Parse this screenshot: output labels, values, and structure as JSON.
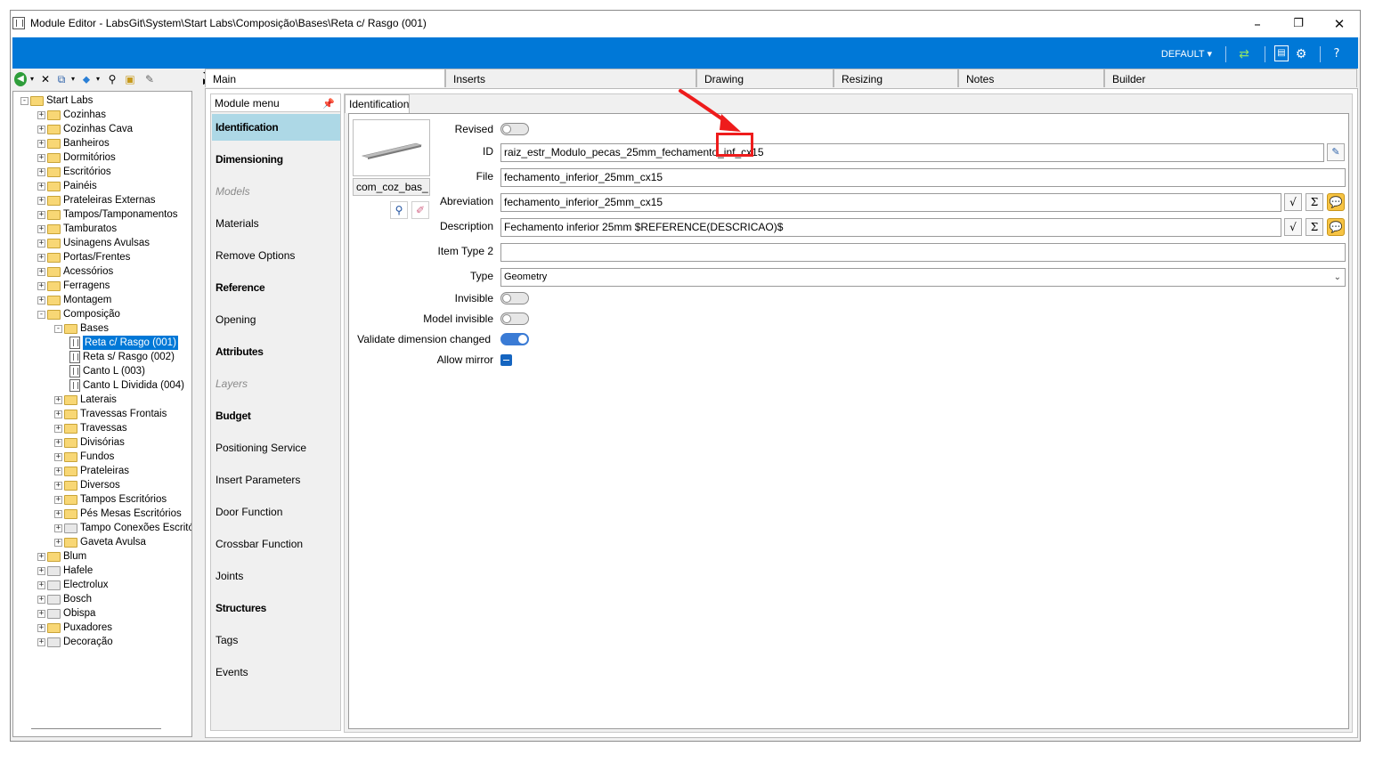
{
  "window": {
    "title": "Module Editor - LabsGit\\System\\Start Labs\\Composição\\Bases\\Reta c/ Rasgo (001)",
    "controls": [
      "–",
      "❐",
      "✕"
    ]
  },
  "bluebar": {
    "profile": "DEFAULT ▾"
  },
  "main_tabs": [
    "Main",
    "Inserts",
    "Drawing",
    "Resizing",
    "Notes",
    "Builder"
  ],
  "tree": {
    "nodes": [
      {
        "label": "Start Labs",
        "level": 0,
        "type": "folder",
        "exp": "−"
      },
      {
        "label": "Cozinhas",
        "level": 1,
        "type": "folder",
        "exp": "+"
      },
      {
        "label": "Cozinhas Cava",
        "level": 1,
        "type": "folder",
        "exp": "+"
      },
      {
        "label": "Banheiros",
        "level": 1,
        "type": "folder",
        "exp": "+"
      },
      {
        "label": "Dormitórios",
        "level": 1,
        "type": "folder",
        "exp": "+"
      },
      {
        "label": "Escritórios",
        "level": 1,
        "type": "folder",
        "exp": "+"
      },
      {
        "label": "Painéis",
        "level": 1,
        "type": "folder",
        "exp": "+"
      },
      {
        "label": "Prateleiras Externas",
        "level": 1,
        "type": "folder",
        "exp": "+"
      },
      {
        "label": "Tampos/Tamponamentos",
        "level": 1,
        "type": "folder",
        "exp": "+"
      },
      {
        "label": "Tamburatos",
        "level": 1,
        "type": "folder",
        "exp": "+"
      },
      {
        "label": "Usinagens Avulsas",
        "level": 1,
        "type": "folder",
        "exp": "+"
      },
      {
        "label": "Portas/Frentes",
        "level": 1,
        "type": "folder",
        "exp": "+"
      },
      {
        "label": "Acessórios",
        "level": 1,
        "type": "folder",
        "exp": "+"
      },
      {
        "label": "Ferragens",
        "level": 1,
        "type": "folder",
        "exp": "+"
      },
      {
        "label": "Montagem",
        "level": 1,
        "type": "folder",
        "exp": "+"
      },
      {
        "label": "Composição",
        "level": 1,
        "type": "folder",
        "exp": "−"
      },
      {
        "label": "Bases",
        "level": 2,
        "type": "folder",
        "exp": "−"
      },
      {
        "label": "Reta c/ Rasgo (001)",
        "level": 3,
        "type": "doc",
        "selected": true
      },
      {
        "label": "Reta s/ Rasgo (002)",
        "level": 3,
        "type": "doc"
      },
      {
        "label": "Canto L (003)",
        "level": 3,
        "type": "doc"
      },
      {
        "label": "Canto L Dividida (004)",
        "level": 3,
        "type": "doc"
      },
      {
        "label": "Laterais",
        "level": 2,
        "type": "folder",
        "exp": "+"
      },
      {
        "label": "Travessas Frontais",
        "level": 2,
        "type": "folder",
        "exp": "+"
      },
      {
        "label": "Travessas",
        "level": 2,
        "type": "folder",
        "exp": "+"
      },
      {
        "label": "Divisórias",
        "level": 2,
        "type": "folder",
        "exp": "+"
      },
      {
        "label": "Fundos",
        "level": 2,
        "type": "folder",
        "exp": "+"
      },
      {
        "label": "Prateleiras",
        "level": 2,
        "type": "folder",
        "exp": "+"
      },
      {
        "label": "Diversos",
        "level": 2,
        "type": "folder",
        "exp": "+"
      },
      {
        "label": "Tampos Escritórios",
        "level": 2,
        "type": "folder",
        "exp": "+"
      },
      {
        "label": "Pés Mesas Escritórios",
        "level": 2,
        "type": "folder",
        "exp": "+"
      },
      {
        "label": "Tampo Conexões Escritórios",
        "level": 2,
        "type": "folder",
        "exp": "+",
        "gray": true
      },
      {
        "label": "Gaveta Avulsa",
        "level": 2,
        "type": "folder",
        "exp": "+"
      },
      {
        "label": "Blum",
        "level": 1,
        "type": "folder",
        "exp": "+"
      },
      {
        "label": "Hafele",
        "level": 1,
        "type": "folder",
        "exp": "+",
        "gray": true
      },
      {
        "label": "Electrolux",
        "level": 1,
        "type": "folder",
        "exp": "+",
        "gray": true
      },
      {
        "label": "Bosch",
        "level": 1,
        "type": "folder",
        "exp": "+",
        "gray": true
      },
      {
        "label": "Obispa",
        "level": 1,
        "type": "folder",
        "exp": "+",
        "gray": true
      },
      {
        "label": "Puxadores",
        "level": 1,
        "type": "folder",
        "exp": "+"
      },
      {
        "label": "Decoração",
        "level": 1,
        "type": "folder",
        "exp": "+",
        "gray": true
      }
    ]
  },
  "module_menu": {
    "header": "Module menu",
    "items": [
      {
        "label": "Identification",
        "style": "bold",
        "active": true
      },
      {
        "label": "Dimensioning",
        "style": "bold"
      },
      {
        "label": "Models",
        "style": "disabled"
      },
      {
        "label": "Materials",
        "style": "normal"
      },
      {
        "label": "Remove Options",
        "style": "normal"
      },
      {
        "label": "Reference",
        "style": "bold"
      },
      {
        "label": "Opening",
        "style": "normal"
      },
      {
        "label": "Attributes",
        "style": "bold"
      },
      {
        "label": "Layers",
        "style": "disabled"
      },
      {
        "label": "Budget",
        "style": "bold"
      },
      {
        "label": "Positioning Service",
        "style": "normal"
      },
      {
        "label": "Insert Parameters",
        "style": "normal"
      },
      {
        "label": "Door Function",
        "style": "normal"
      },
      {
        "label": "Crossbar Function",
        "style": "normal"
      },
      {
        "label": "Joints",
        "style": "normal"
      },
      {
        "label": "Structures",
        "style": "bold"
      },
      {
        "label": "Tags",
        "style": "normal"
      },
      {
        "label": "Events",
        "style": "normal"
      }
    ]
  },
  "identification": {
    "tab_label": "Identification",
    "thumbnail_name": "com_coz_bas_",
    "labels": {
      "revised": "Revised",
      "id": "ID",
      "file": "File",
      "abreviation": "Abreviation",
      "description": "Description",
      "item_type2": "Item Type 2",
      "type": "Type",
      "invisible": "Invisible",
      "model_invisible": "Model invisible",
      "validate": "Validate dimension changed",
      "allow_mirror": "Allow mirror"
    },
    "values": {
      "id": "raiz_estr_Modulo_pecas_25mm_fechamento_inf_cx15",
      "file": "fechamento_inferior_25mm_cx15",
      "abreviation": "fechamento_inferior_25mm_cx15",
      "description": "Fechamento inferior 25mm $REFERENCE(DESCRICAO)$",
      "item_type2": "",
      "type": "Geometry"
    },
    "switches": {
      "revised": "off",
      "invisible": "off",
      "model_invisible": "off",
      "validate": "on",
      "allow_mirror": "checked"
    }
  },
  "colors": {
    "accent": "#0078d7",
    "annotation": "#ee1c1c",
    "menu_active": "#add8e6"
  }
}
